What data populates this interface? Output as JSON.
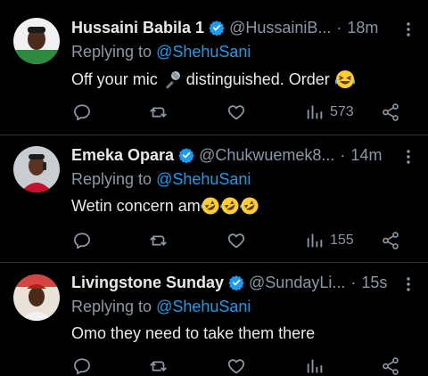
{
  "tweets": [
    {
      "name": "Hussaini Babila 1",
      "handle": "@HussainiB...",
      "dot": "·",
      "time": "18m",
      "reply_prefix": "Replying to ",
      "reply_to": "@ShehuSani",
      "text_before": "Off your mic ",
      "text_after": " distinguished. Order ",
      "views": "573"
    },
    {
      "name": "Emeka Opara",
      "handle": "@Chukwuemek8...",
      "dot": "·",
      "time": "14m",
      "reply_prefix": "Replying to ",
      "reply_to": "@ShehuSani",
      "text": "Wetin concern am",
      "views": "155"
    },
    {
      "name": "Livingstone Sunday",
      "handle": "@SundayLi...",
      "dot": "·",
      "time": "15s",
      "reply_prefix": "Replying to ",
      "reply_to": "@ShehuSani",
      "text": "Omo they need to take them there",
      "views": ""
    }
  ],
  "colors": {
    "background": "#000000",
    "text": "#e7e9ea",
    "muted": "#8b98a5",
    "link": "#1d9bf0",
    "verified": "#1d9bf0",
    "divider": "#2f3336"
  }
}
